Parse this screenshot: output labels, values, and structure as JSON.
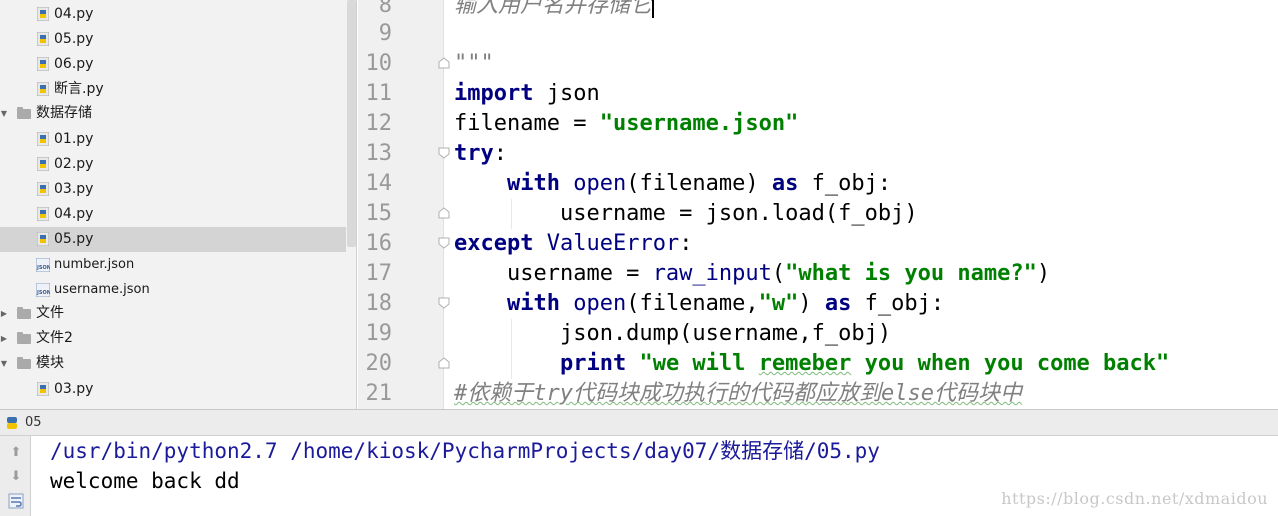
{
  "tree": {
    "items": [
      {
        "label": "04.py",
        "type": "py"
      },
      {
        "label": "05.py",
        "type": "py"
      },
      {
        "label": "06.py",
        "type": "py"
      },
      {
        "label": "断言.py",
        "type": "py"
      },
      {
        "label": "数据存储",
        "type": "folder",
        "expanded": true
      },
      {
        "label": "01.py",
        "type": "py"
      },
      {
        "label": "02.py",
        "type": "py"
      },
      {
        "label": "03.py",
        "type": "py"
      },
      {
        "label": "04.py",
        "type": "py"
      },
      {
        "label": "05.py",
        "type": "py",
        "selected": true
      },
      {
        "label": "number.json",
        "type": "json"
      },
      {
        "label": "username.json",
        "type": "json"
      },
      {
        "label": "文件",
        "type": "folder",
        "expanded": false
      },
      {
        "label": "文件2",
        "type": "folder",
        "expanded": false
      },
      {
        "label": "模块",
        "type": "folder",
        "expanded": true
      },
      {
        "label": "03.py",
        "type": "py"
      }
    ]
  },
  "editor": {
    "line_numbers": [
      "8",
      "9",
      "10",
      "11",
      "12",
      "13",
      "14",
      "15",
      "16",
      "17",
      "18",
      "19",
      "20",
      "21"
    ],
    "lines": {
      "l8": "输入用户名并存储它",
      "l10": "\"\"\"",
      "l11_kw": "import",
      "l11_rest": " json",
      "l12_a": "filename = ",
      "l12_str": "\"username.json\"",
      "l13_kw": "try",
      "l13_rest": ":",
      "l14_indent": "    ",
      "l14_kw": "with",
      "l14_sp": " ",
      "l14_bi": "open",
      "l14_mid": "(filename) ",
      "l14_kw2": "as",
      "l14_rest": " f_obj:",
      "l15": "        username = json.load(f_obj)",
      "l16_kw": "except",
      "l16_sp": " ",
      "l16_bi": "ValueError",
      "l16_rest": ":",
      "l17_a": "    username = ",
      "l17_bi": "raw_input",
      "l17_b": "(",
      "l17_str": "\"what is you name?\"",
      "l17_c": ")",
      "l18_indent": "    ",
      "l18_kw": "with",
      "l18_sp": " ",
      "l18_bi": "open",
      "l18_a": "(filename,",
      "l18_str": "\"w\"",
      "l18_b": ") ",
      "l18_kw2": "as",
      "l18_rest": " f_obj:",
      "l19": "        json.dump(username,f_obj)",
      "l20_indent": "        ",
      "l20_kw": "print",
      "l20_sp": " ",
      "l20_str1": "\"we will ",
      "l20_str2": "remeber",
      "l20_str3": " you when you come back\"",
      "l21": "#依赖于try代码块成功执行的代码都应放到else代码块中"
    }
  },
  "run": {
    "title": "05",
    "command": "/usr/bin/python2.7 /home/kiosk/PycharmProjects/day07/数据存储/05.py",
    "output": "welcome back dd"
  },
  "watermark": "https://blog.csdn.net/xdmaidou",
  "colors": {
    "keyword": "#000080",
    "string": "#008000",
    "comment": "#808080",
    "selection": "#d4d4d4"
  }
}
